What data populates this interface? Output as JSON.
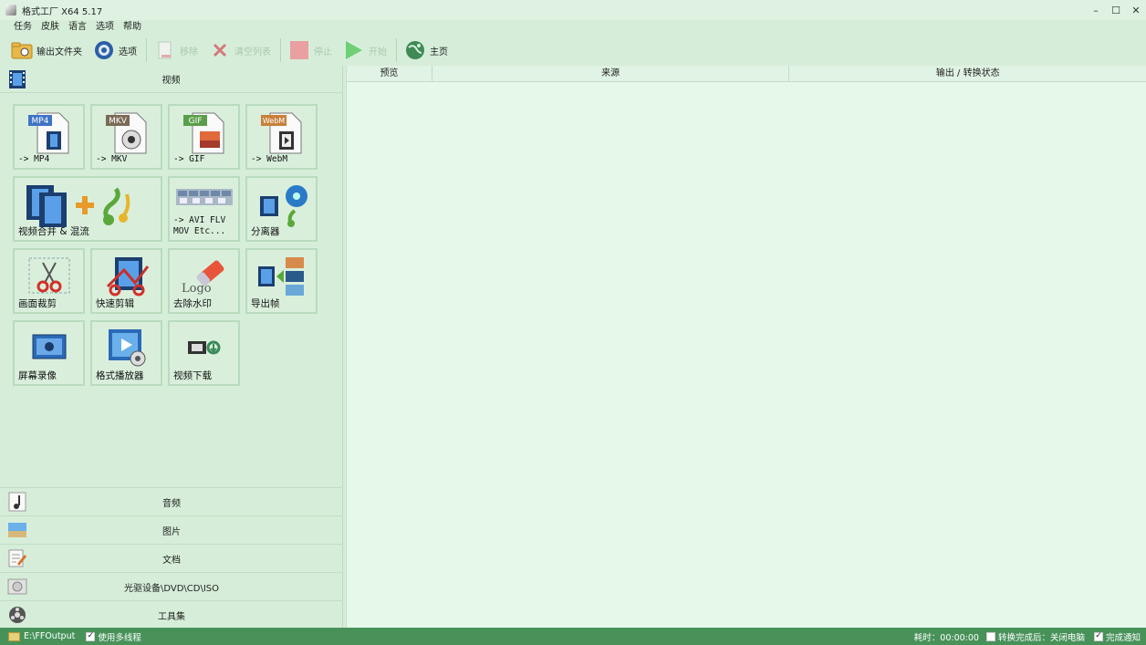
{
  "window": {
    "title": "格式工厂 X64 5.17",
    "controls": [
      "–",
      "☐",
      "✕"
    ]
  },
  "menu": [
    "任务",
    "皮肤",
    "语言",
    "选项",
    "帮助"
  ],
  "toolbar": {
    "output_folder": "输出文件夹",
    "options": "选项",
    "remove": "移除",
    "clear_list": "清空列表",
    "stop": "停止",
    "start": "开始",
    "home": "主页"
  },
  "left_panel": {
    "video_category": "视频",
    "tiles": [
      {
        "label": "-> MP4",
        "badge": "MP4",
        "color": "#3f74c6"
      },
      {
        "label": "-> MKV",
        "badge": "MKV",
        "color": "#7a6a55"
      },
      {
        "label": "-> GIF",
        "badge": "GIF",
        "color": "#5a9e4a"
      },
      {
        "label": "-> WebM",
        "badge": "WebM",
        "color": "#c8803a"
      },
      {
        "label": "视频合并 & 混流"
      },
      {
        "label_line1": "-> AVI FLV",
        "label_line2": "MOV Etc..."
      },
      {
        "label": "分离器"
      },
      {
        "label": "画面裁剪"
      },
      {
        "label": "快速剪辑"
      },
      {
        "label": "去除水印",
        "logo_text": "Logo"
      },
      {
        "label": "导出帧"
      },
      {
        "label": "屏幕录像"
      },
      {
        "label": "格式播放器"
      },
      {
        "label": "视频下载"
      }
    ],
    "other_categories": [
      "音频",
      "图片",
      "文档",
      "光驱设备\\DVD\\CD\\ISO",
      "工具集"
    ]
  },
  "task_table": {
    "columns": [
      "预览",
      "来源",
      "输出 / 转换状态"
    ]
  },
  "status_bar": {
    "output_path": "E:\\FFOutput",
    "multithread_label": "使用多线程",
    "multithread_checked": true,
    "elapsed": "耗时：00:00:00",
    "after_convert_label": "转换完成后：关闭电脑",
    "after_convert_checked": false,
    "notify_label": "完成通知",
    "notify_checked": true
  }
}
